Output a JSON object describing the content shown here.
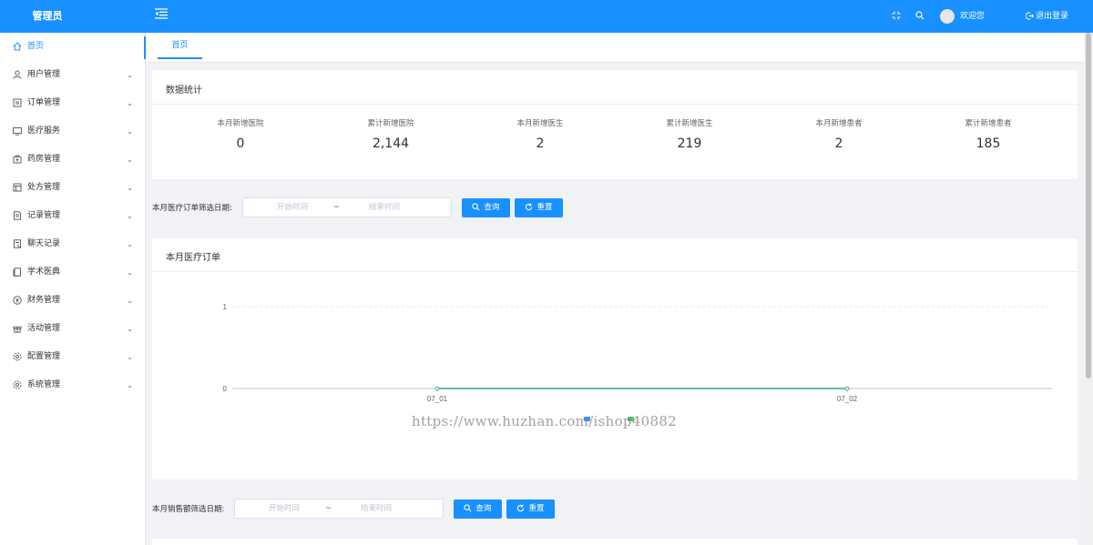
{
  "header": {
    "logo": "管理员",
    "welcome": "欢迎您",
    "logout": "退出登录",
    "primary_color": "#1890ff",
    "icons": [
      "menu-fold-icon",
      "fullscreen-icon",
      "search-icon",
      "logout-icon"
    ]
  },
  "sidebar": {
    "items": [
      {
        "label": "首页",
        "icon": "home-icon",
        "active": true,
        "expandable": false
      },
      {
        "label": "用户管理",
        "icon": "user-icon",
        "expandable": true
      },
      {
        "label": "订单管理",
        "icon": "order-icon",
        "expandable": true
      },
      {
        "label": "医疗服务",
        "icon": "monitor-icon",
        "expandable": true
      },
      {
        "label": "药房管理",
        "icon": "pharmacy-icon",
        "expandable": true
      },
      {
        "label": "处方管理",
        "icon": "prescription-icon",
        "expandable": true
      },
      {
        "label": "记录管理",
        "icon": "record-icon",
        "expandable": true
      },
      {
        "label": "聊天记录",
        "icon": "chat-record-icon",
        "expandable": true
      },
      {
        "label": "学术医典",
        "icon": "book-icon",
        "expandable": true
      },
      {
        "label": "财务管理",
        "icon": "money-icon",
        "expandable": true
      },
      {
        "label": "活动管理",
        "icon": "gift-icon",
        "expandable": true
      },
      {
        "label": "配置管理",
        "icon": "settings-icon",
        "expandable": true
      },
      {
        "label": "系统管理",
        "icon": "gear-icon",
        "expandable": true
      }
    ]
  },
  "tabs": [
    {
      "label": "首页",
      "active": true
    }
  ],
  "stats": {
    "title": "数据统计",
    "items": [
      {
        "label": "本月新增医院",
        "value": "0"
      },
      {
        "label": "累计新增医院",
        "value": "2,144"
      },
      {
        "label": "本月新增医生",
        "value": "2"
      },
      {
        "label": "累计新增医生",
        "value": "219"
      },
      {
        "label": "本月新增患者",
        "value": "2"
      },
      {
        "label": "累计新增患者",
        "value": "185"
      }
    ]
  },
  "filter1": {
    "label": "本月医疗订单筛选日期:",
    "start_placeholder": "开始时间",
    "separator": "~",
    "end_placeholder": "结束时间",
    "search": "查询",
    "reset": "重置"
  },
  "filter2": {
    "label": "本月销售额筛选日期:",
    "start_placeholder": "开始时间",
    "separator": "~",
    "end_placeholder": "结束时间",
    "search": "查询",
    "reset": "重置"
  },
  "chart": {
    "title": "本月医疗订单"
  },
  "chart_data": {
    "type": "line",
    "title": "本月医疗订单",
    "categories": [
      "07_01",
      "07_02"
    ],
    "ylim": [
      0,
      1
    ],
    "yticks": [
      0,
      1
    ],
    "grid": true,
    "legend_placement": "bottom",
    "series": [
      {
        "name": "",
        "values": [
          0,
          0
        ],
        "color": "#3b8ff3"
      },
      {
        "name": "",
        "values": [
          0,
          0
        ],
        "color": "#4cc26c"
      }
    ]
  },
  "watermark": "https://www.huzhan.com/ishop40882"
}
